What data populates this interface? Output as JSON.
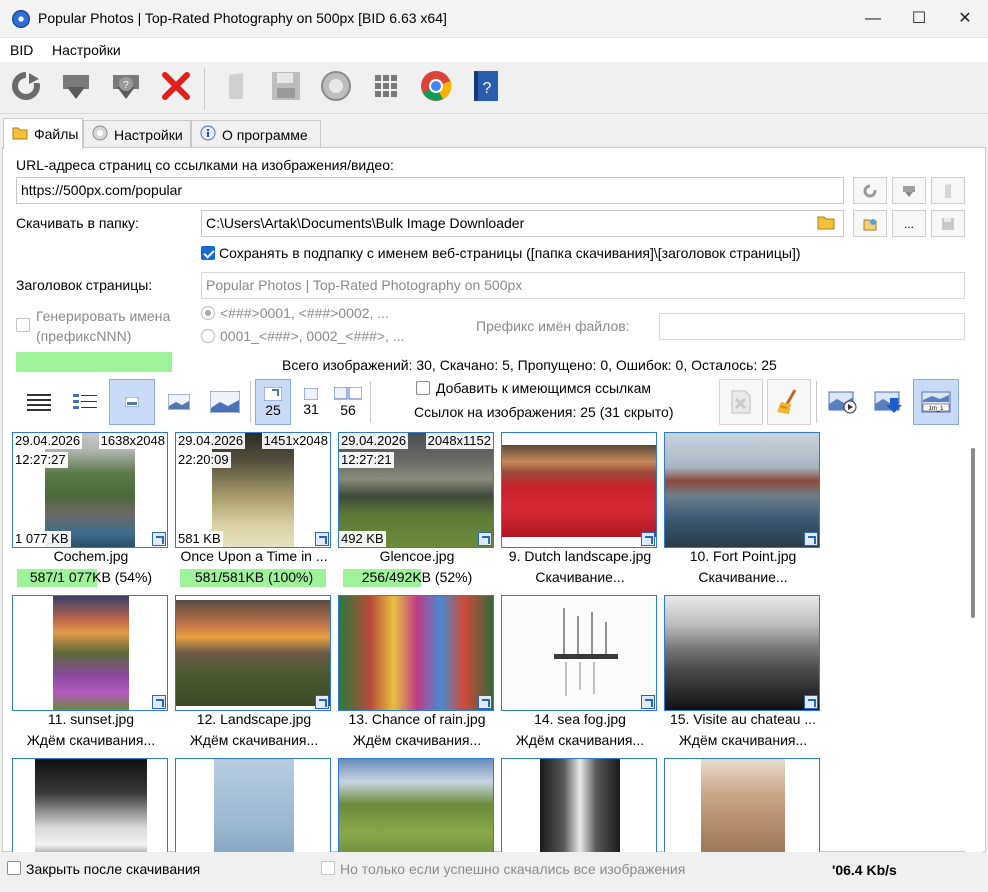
{
  "window": {
    "title": "Popular Photos | Top-Rated Photography on 500px [BID 6.63 x64]",
    "controls": [
      "—",
      "☐",
      "✕"
    ]
  },
  "menu": [
    "BID",
    "Настройки"
  ],
  "toolbar": {
    "icons": [
      "refresh-icon",
      "download-icon",
      "help-download-icon",
      "stop-icon",
      "clear-icon",
      "save-icon",
      "settings-icon",
      "grid-icon",
      "chrome-icon",
      "help-icon"
    ]
  },
  "tabs": [
    {
      "label": "Файлы",
      "icon": "folder-icon"
    },
    {
      "label": "Настройки",
      "icon": "gear-icon"
    },
    {
      "label": "О программе",
      "icon": "info-icon"
    }
  ],
  "form": {
    "url_label": "URL-адреса страниц со ссылками на изображения/видео:",
    "url_value": "https://500px.com/popular",
    "folder_label": "Скачивать в папку:",
    "folder_value": "C:\\Users\\Artak\\Documents\\Bulk Image Downloader",
    "browse_label": "...",
    "subfolder_label": "Сохранять в подпапку с именем веб-страницы ([папка скачивания]\\[заголовок страницы])",
    "subfolder_checked": true,
    "page_title_label": "Заголовок страницы:",
    "page_title_value": "Popular Photos | Top-Rated Photography on 500px",
    "gen_names_label_1": "Генерировать имена",
    "gen_names_label_2": "(префиксNNN)",
    "radio_1": "<###>0001, <###>0002, ...",
    "radio_2": "0001_<###>, 0002_<###>, ...",
    "prefix_label": "Префикс имён файлов:",
    "prefix_value": ""
  },
  "summary": "Всего изображений: 30, Скачано: 5, Пропущено: 0, Ошибок: 0, Осталось: 25",
  "view": {
    "counts": [
      "25",
      "31",
      "56"
    ],
    "append_label": "Добавить к имеющимся ссылкам",
    "links_label": "Ссылок на изображения: 25 (31 скрыто)"
  },
  "images": [
    {
      "date": "29.04.2026",
      "time": "12:27:27",
      "dims": "1638x2048",
      "size": "1 077 KB",
      "name": "Cochem.jpg",
      "status": "587/1 077KB (54%)",
      "progress": 0.54
    },
    {
      "date": "29.04.2026",
      "time": "22:20:09",
      "dims": "1451x2048",
      "size": "581 KB",
      "name": "Once Upon a Time in ...",
      "status": "581/581KB (100%)",
      "progress": 1.0
    },
    {
      "date": "29.04.2026",
      "time": "12:27:21",
      "dims": "2048x1152",
      "size": "492 KB",
      "name": "Glencoe.jpg",
      "status": "256/492KB (52%)",
      "progress": 0.52
    },
    {
      "name": "9. Dutch landscape.jpg",
      "status": "Скачивание..."
    },
    {
      "name": "10. Fort Point.jpg",
      "status": "Скачивание..."
    },
    {
      "name": "11. sunset.jpg",
      "status": "Ждём скачивания..."
    },
    {
      "name": "12. Landscape.jpg",
      "status": "Ждём скачивания..."
    },
    {
      "name": "13. Chance of rain.jpg",
      "status": "Ждём скачивания..."
    },
    {
      "name": "14. sea fog.jpg",
      "status": "Ждём скачивания..."
    },
    {
      "name": "15. Visite au chateau ...",
      "status": "Ждём скачивания..."
    },
    {
      "name": "",
      "status": ""
    },
    {
      "name": "",
      "status": ""
    },
    {
      "name": "",
      "status": ""
    },
    {
      "name": "",
      "status": ""
    },
    {
      "name": "",
      "status": ""
    }
  ],
  "status": {
    "close_after": "Закрыть после скачивания",
    "only_if": "Но только если успешно скачались все изображения",
    "speed": "'06.4 Kb/s"
  },
  "colors": {
    "accent": "#1967d2",
    "progress": "#9ef29a",
    "stop": "#e0201b"
  }
}
